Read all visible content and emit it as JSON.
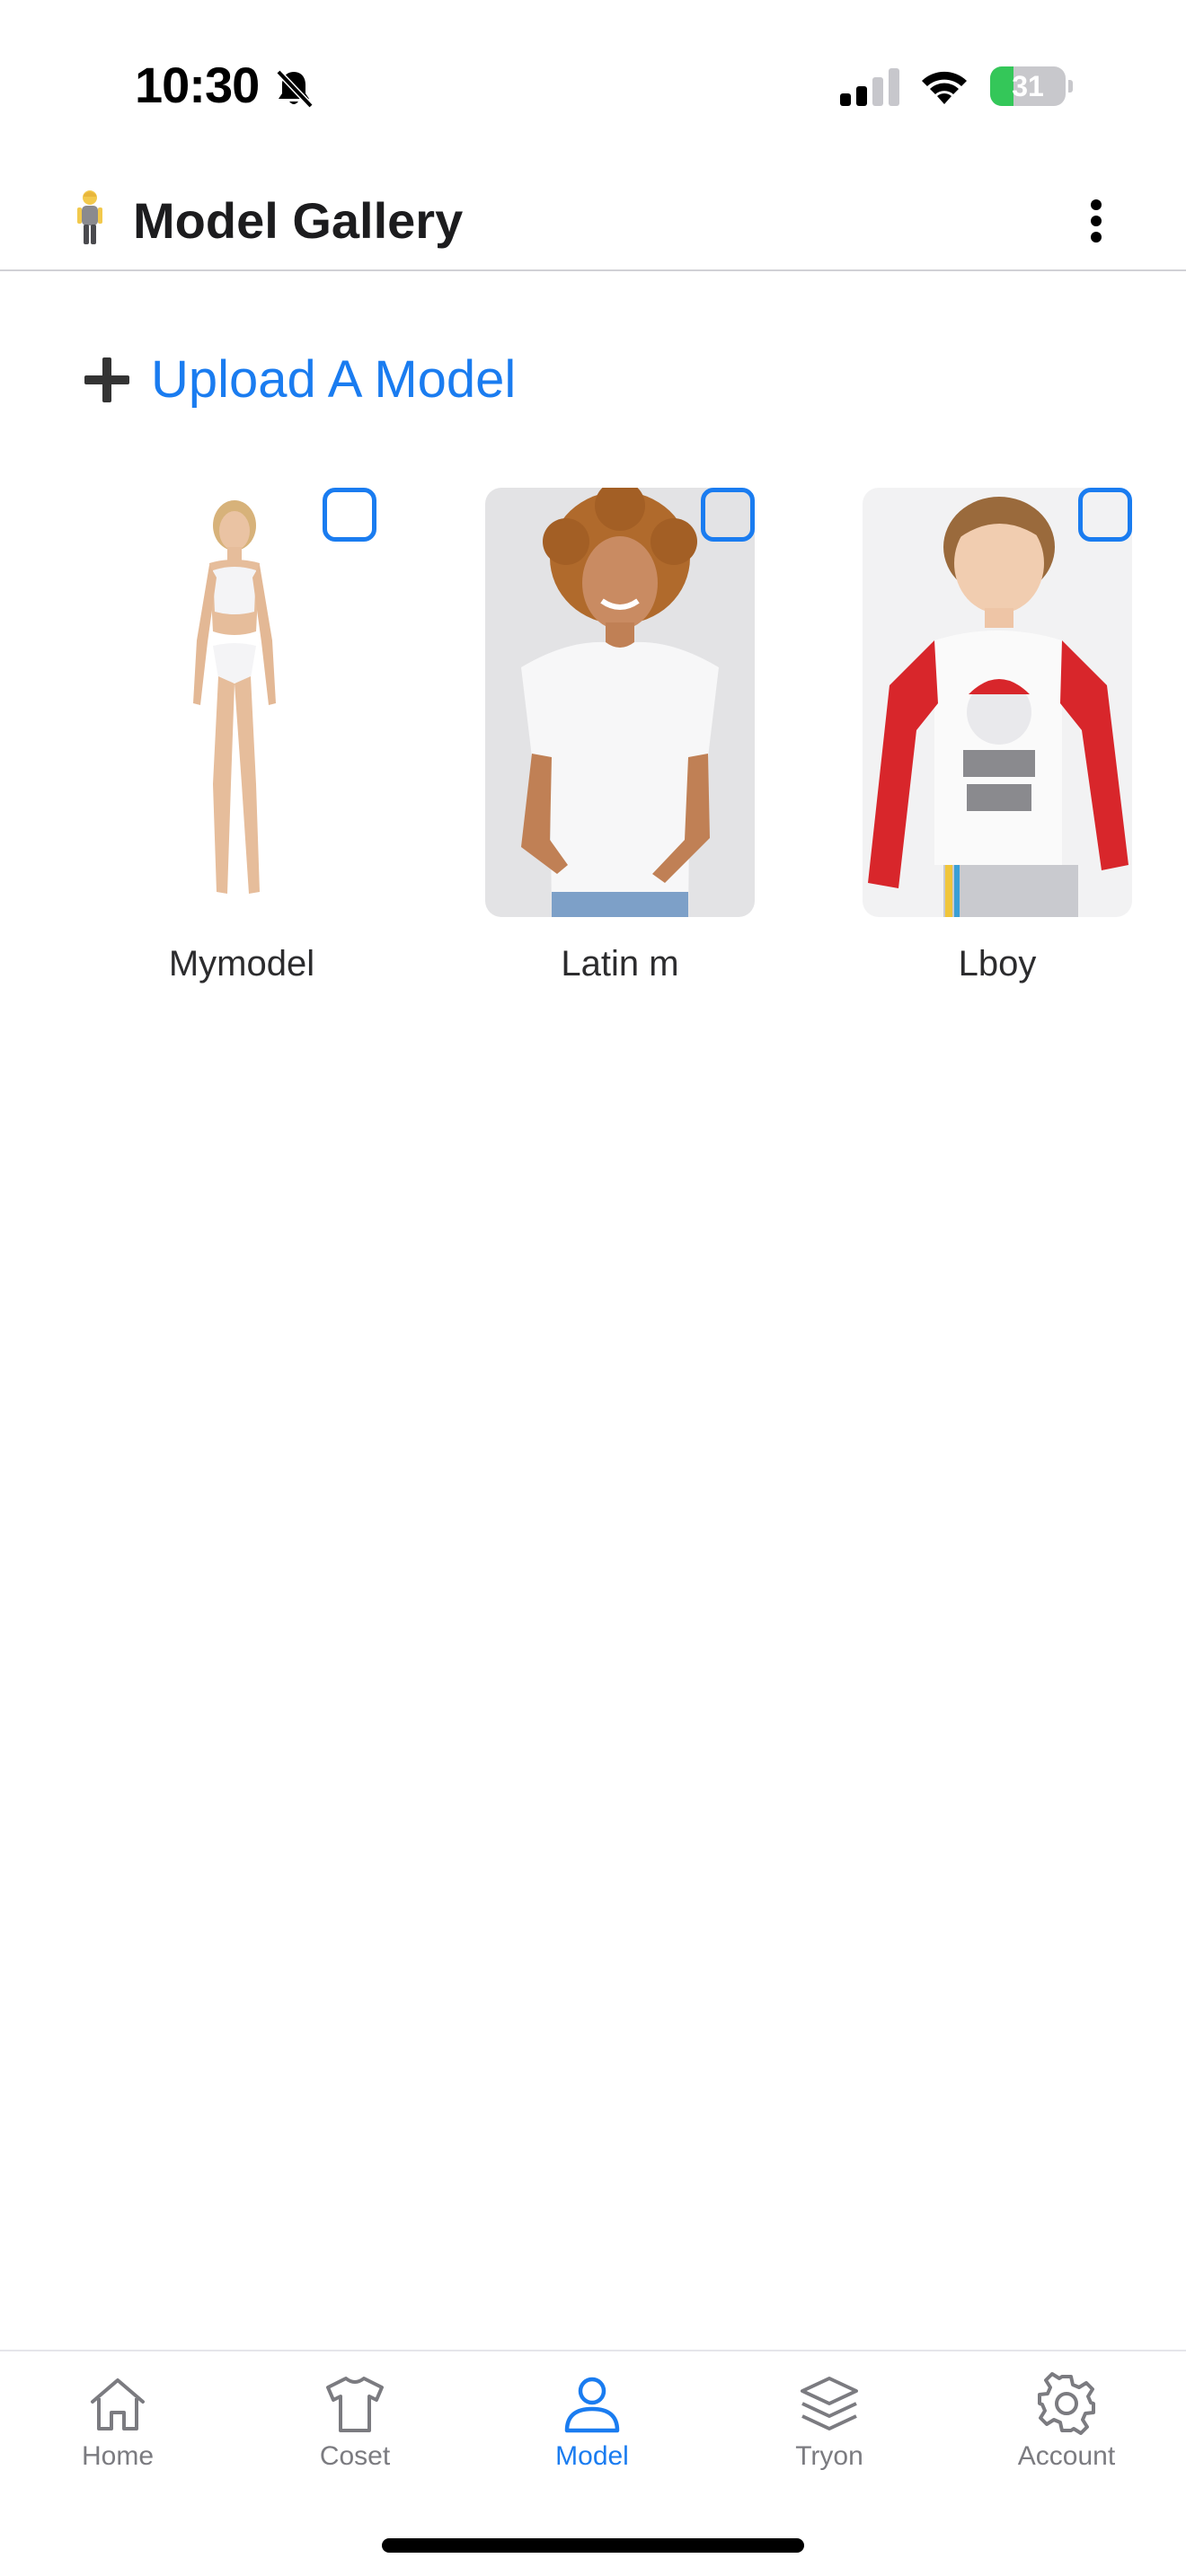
{
  "status_bar": {
    "time": "10:30",
    "battery_percent": "31",
    "battery_level": 0.31,
    "silent_icon": "bell-slash-icon",
    "signal_icon": "cellular-signal-icon",
    "wifi_icon": "wifi-icon",
    "charging": true
  },
  "header": {
    "title": "Model Gallery",
    "emoji_icon": "person-standing-icon",
    "menu_icon": "more-vertical-icon"
  },
  "upload": {
    "label": "Upload A Model",
    "icon": "plus-icon"
  },
  "models": [
    {
      "name": "Mymodel",
      "selected": false
    },
    {
      "name": "Latin m",
      "selected": false
    },
    {
      "name": "Lboy",
      "selected": false
    }
  ],
  "tabs": [
    {
      "label": "Home",
      "icon": "home-icon",
      "active": false
    },
    {
      "label": "Coset",
      "icon": "shirt-icon",
      "active": false
    },
    {
      "label": "Model",
      "icon": "person-icon",
      "active": true
    },
    {
      "label": "Tryon",
      "icon": "layers-icon",
      "active": false
    },
    {
      "label": "Account",
      "icon": "gear-icon",
      "active": false
    }
  ],
  "colors": {
    "accent": "#1a7cf0",
    "battery_green": "#34c759",
    "inactive_tab": "#7b7b80"
  }
}
